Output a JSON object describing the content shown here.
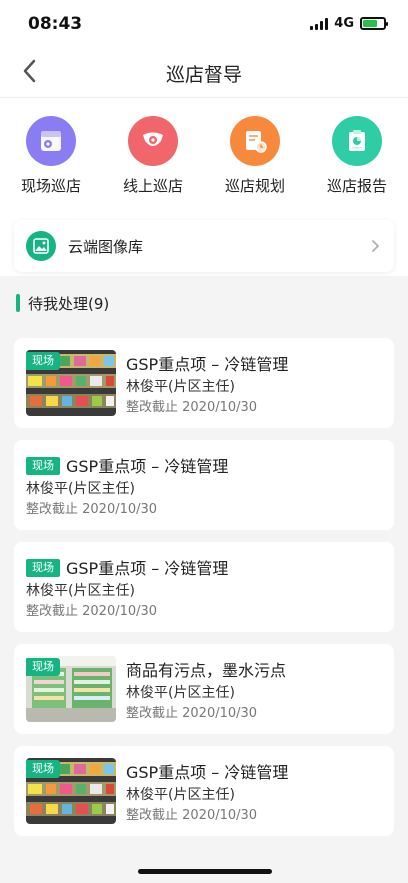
{
  "status": {
    "time": "08:43",
    "network": "4G"
  },
  "nav": {
    "title": "巡店督导"
  },
  "quick_menu": [
    {
      "label": "现场巡店",
      "icon": "store-inspection-icon",
      "color": "#8a7df3"
    },
    {
      "label": "线上巡店",
      "icon": "camera-icon",
      "color": "#f0666a"
    },
    {
      "label": "巡店规划",
      "icon": "plan-clock-icon",
      "color": "#f7893c"
    },
    {
      "label": "巡店报告",
      "icon": "report-icon",
      "color": "#2fcda5"
    }
  ],
  "cloud": {
    "label": "云端图像库",
    "icon": "image-library-icon"
  },
  "section": {
    "title": "待我处理(9)"
  },
  "tasks": [
    {
      "tag": "现场",
      "title": "GSP重点项 – 冷链管理",
      "person": "林俊平(片区主任)",
      "deadline": "整改截止 2020/10/30",
      "has_image": true
    },
    {
      "tag": "现场",
      "title": "GSP重点项 – 冷链管理",
      "person": "林俊平(片区主任)",
      "deadline": "整改截止 2020/10/30",
      "has_image": false
    },
    {
      "tag": "现场",
      "title": "GSP重点项 – 冷链管理",
      "person": "林俊平(片区主任)",
      "deadline": "整改截止 2020/10/30",
      "has_image": false
    },
    {
      "tag": "现场",
      "title": "商品有污点，墨水污点",
      "person": "林俊平(片区主任)",
      "deadline": "整改截止 2020/10/30",
      "has_image": true
    },
    {
      "tag": "现场",
      "title": "GSP重点项 – 冷链管理",
      "person": "林俊平(片区主任)",
      "deadline": "整改截止 2020/10/30",
      "has_image": true
    }
  ],
  "colors": {
    "accent": "#16b383",
    "background": "#f4f4f4"
  }
}
